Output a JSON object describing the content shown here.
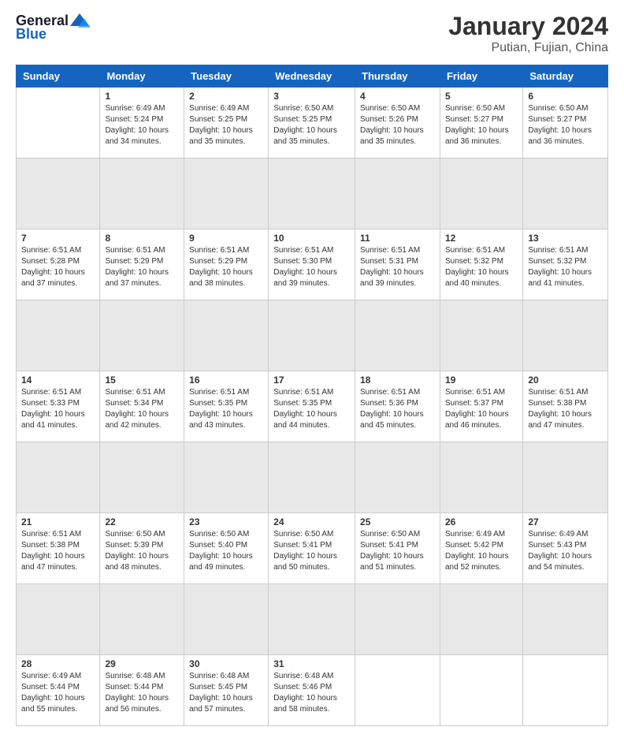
{
  "logo": {
    "general": "General",
    "blue": "Blue"
  },
  "header": {
    "title": "January 2024",
    "subtitle": "Putian, Fujian, China"
  },
  "days_of_week": [
    "Sunday",
    "Monday",
    "Tuesday",
    "Wednesday",
    "Thursday",
    "Friday",
    "Saturday"
  ],
  "weeks": [
    [
      {
        "day": "",
        "sunrise": "",
        "sunset": "",
        "daylight": ""
      },
      {
        "day": "1",
        "sunrise": "Sunrise: 6:49 AM",
        "sunset": "Sunset: 5:24 PM",
        "daylight": "Daylight: 10 hours and 34 minutes."
      },
      {
        "day": "2",
        "sunrise": "Sunrise: 6:49 AM",
        "sunset": "Sunset: 5:25 PM",
        "daylight": "Daylight: 10 hours and 35 minutes."
      },
      {
        "day": "3",
        "sunrise": "Sunrise: 6:50 AM",
        "sunset": "Sunset: 5:25 PM",
        "daylight": "Daylight: 10 hours and 35 minutes."
      },
      {
        "day": "4",
        "sunrise": "Sunrise: 6:50 AM",
        "sunset": "Sunset: 5:26 PM",
        "daylight": "Daylight: 10 hours and 35 minutes."
      },
      {
        "day": "5",
        "sunrise": "Sunrise: 6:50 AM",
        "sunset": "Sunset: 5:27 PM",
        "daylight": "Daylight: 10 hours and 36 minutes."
      },
      {
        "day": "6",
        "sunrise": "Sunrise: 6:50 AM",
        "sunset": "Sunset: 5:27 PM",
        "daylight": "Daylight: 10 hours and 36 minutes."
      }
    ],
    [
      {
        "day": "7",
        "sunrise": "Sunrise: 6:51 AM",
        "sunset": "Sunset: 5:28 PM",
        "daylight": "Daylight: 10 hours and 37 minutes."
      },
      {
        "day": "8",
        "sunrise": "Sunrise: 6:51 AM",
        "sunset": "Sunset: 5:29 PM",
        "daylight": "Daylight: 10 hours and 37 minutes."
      },
      {
        "day": "9",
        "sunrise": "Sunrise: 6:51 AM",
        "sunset": "Sunset: 5:29 PM",
        "daylight": "Daylight: 10 hours and 38 minutes."
      },
      {
        "day": "10",
        "sunrise": "Sunrise: 6:51 AM",
        "sunset": "Sunset: 5:30 PM",
        "daylight": "Daylight: 10 hours and 39 minutes."
      },
      {
        "day": "11",
        "sunrise": "Sunrise: 6:51 AM",
        "sunset": "Sunset: 5:31 PM",
        "daylight": "Daylight: 10 hours and 39 minutes."
      },
      {
        "day": "12",
        "sunrise": "Sunrise: 6:51 AM",
        "sunset": "Sunset: 5:32 PM",
        "daylight": "Daylight: 10 hours and 40 minutes."
      },
      {
        "day": "13",
        "sunrise": "Sunrise: 6:51 AM",
        "sunset": "Sunset: 5:32 PM",
        "daylight": "Daylight: 10 hours and 41 minutes."
      }
    ],
    [
      {
        "day": "14",
        "sunrise": "Sunrise: 6:51 AM",
        "sunset": "Sunset: 5:33 PM",
        "daylight": "Daylight: 10 hours and 41 minutes."
      },
      {
        "day": "15",
        "sunrise": "Sunrise: 6:51 AM",
        "sunset": "Sunset: 5:34 PM",
        "daylight": "Daylight: 10 hours and 42 minutes."
      },
      {
        "day": "16",
        "sunrise": "Sunrise: 6:51 AM",
        "sunset": "Sunset: 5:35 PM",
        "daylight": "Daylight: 10 hours and 43 minutes."
      },
      {
        "day": "17",
        "sunrise": "Sunrise: 6:51 AM",
        "sunset": "Sunset: 5:35 PM",
        "daylight": "Daylight: 10 hours and 44 minutes."
      },
      {
        "day": "18",
        "sunrise": "Sunrise: 6:51 AM",
        "sunset": "Sunset: 5:36 PM",
        "daylight": "Daylight: 10 hours and 45 minutes."
      },
      {
        "day": "19",
        "sunrise": "Sunrise: 6:51 AM",
        "sunset": "Sunset: 5:37 PM",
        "daylight": "Daylight: 10 hours and 46 minutes."
      },
      {
        "day": "20",
        "sunrise": "Sunrise: 6:51 AM",
        "sunset": "Sunset: 5:38 PM",
        "daylight": "Daylight: 10 hours and 47 minutes."
      }
    ],
    [
      {
        "day": "21",
        "sunrise": "Sunrise: 6:51 AM",
        "sunset": "Sunset: 5:38 PM",
        "daylight": "Daylight: 10 hours and 47 minutes."
      },
      {
        "day": "22",
        "sunrise": "Sunrise: 6:50 AM",
        "sunset": "Sunset: 5:39 PM",
        "daylight": "Daylight: 10 hours and 48 minutes."
      },
      {
        "day": "23",
        "sunrise": "Sunrise: 6:50 AM",
        "sunset": "Sunset: 5:40 PM",
        "daylight": "Daylight: 10 hours and 49 minutes."
      },
      {
        "day": "24",
        "sunrise": "Sunrise: 6:50 AM",
        "sunset": "Sunset: 5:41 PM",
        "daylight": "Daylight: 10 hours and 50 minutes."
      },
      {
        "day": "25",
        "sunrise": "Sunrise: 6:50 AM",
        "sunset": "Sunset: 5:41 PM",
        "daylight": "Daylight: 10 hours and 51 minutes."
      },
      {
        "day": "26",
        "sunrise": "Sunrise: 6:49 AM",
        "sunset": "Sunset: 5:42 PM",
        "daylight": "Daylight: 10 hours and 52 minutes."
      },
      {
        "day": "27",
        "sunrise": "Sunrise: 6:49 AM",
        "sunset": "Sunset: 5:43 PM",
        "daylight": "Daylight: 10 hours and 54 minutes."
      }
    ],
    [
      {
        "day": "28",
        "sunrise": "Sunrise: 6:49 AM",
        "sunset": "Sunset: 5:44 PM",
        "daylight": "Daylight: 10 hours and 55 minutes."
      },
      {
        "day": "29",
        "sunrise": "Sunrise: 6:48 AM",
        "sunset": "Sunset: 5:44 PM",
        "daylight": "Daylight: 10 hours and 56 minutes."
      },
      {
        "day": "30",
        "sunrise": "Sunrise: 6:48 AM",
        "sunset": "Sunset: 5:45 PM",
        "daylight": "Daylight: 10 hours and 57 minutes."
      },
      {
        "day": "31",
        "sunrise": "Sunrise: 6:48 AM",
        "sunset": "Sunset: 5:46 PM",
        "daylight": "Daylight: 10 hours and 58 minutes."
      },
      {
        "day": "",
        "sunrise": "",
        "sunset": "",
        "daylight": ""
      },
      {
        "day": "",
        "sunrise": "",
        "sunset": "",
        "daylight": ""
      },
      {
        "day": "",
        "sunrise": "",
        "sunset": "",
        "daylight": ""
      }
    ]
  ]
}
